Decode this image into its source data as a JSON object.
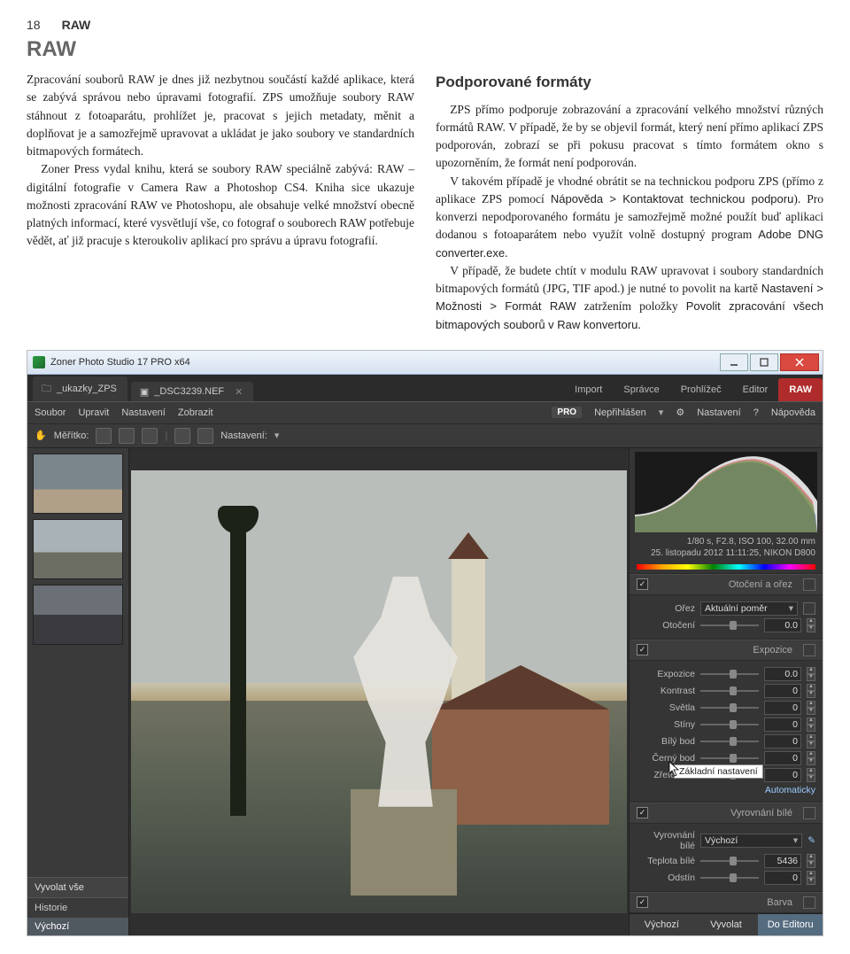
{
  "page": {
    "number": "18",
    "header": "RAW",
    "chapter_title": "RAW"
  },
  "left_column": {
    "p1": "Zpracování souborů RAW je dnes již nezbytnou součástí každé aplikace, která se zabývá správou nebo úpravami fotografií. ZPS umožňuje soubory RAW stáhnout z fotoaparátu, prohlížet je, pracovat s jejich metadaty, měnit a doplňovat je a samozřejmě upravovat a ukládat je jako soubory ve standardních bitmapových formátech.",
    "p2": "Zoner Press vydal knihu, která se soubory RAW speciálně zabývá: RAW – digitální fotografie v Camera Raw a Photoshop CS4. Kniha sice ukazuje možnosti zpracování RAW ve Photoshopu, ale obsahuje velké množství obecně platných informací, které vysvětlují vše, co fotograf o souborech RAW potřebuje vědět, ať již pracuje s kteroukoliv aplikací pro správu a úpravu fotografií."
  },
  "right_column": {
    "section_title": "Podporované formáty",
    "p1": "ZPS přímo podporuje zobrazování a zpracování velkého množství různých formátů RAW. V případě, že by se objevil formát, který není přímo aplikací ZPS podporován, zobrazí se při pokusu pracovat s tímto formátem okno s upozorněním, že formát není podporován.",
    "p2_a": "V takovém případě je vhodné obrátit se na technickou podporu ZPS (přímo z aplikace ZPS pomocí ",
    "p2_menu1": "Nápověda > Kontaktovat technickou podporu",
    "p2_b": "). Pro konverzi nepodporovaného formátu je samozřejmě možné použít buď aplikaci dodanou s fotoaparátem nebo využít volně dostupný program ",
    "p2_app": "Adobe DNG converter.exe",
    "p2_c": ".",
    "p3_a": "V případě, že budete chtít v modulu RAW upravovat i soubory standardních bitmapových formátů (JPG, TIF apod.) je nutné to povolit na kartě ",
    "p3_menu": "Nastavení > Možnosti > Formát RAW",
    "p3_b": " zatržením položky ",
    "p3_item": "Povolit zpracování všech bitmapových souborů v Raw konvertoru",
    "p3_c": "."
  },
  "app": {
    "title": "Zoner Photo Studio 17 PRO x64",
    "folder_tab": "_ukazky_ZPS",
    "file_tab": "_DSC3239.NEF",
    "modules": {
      "import": "Import",
      "manager": "Správce",
      "viewer": "Prohlížeč",
      "editor": "Editor",
      "raw": "RAW"
    },
    "menu": {
      "file": "Soubor",
      "edit": "Upravit",
      "settings": "Nastavení",
      "view": "Zobrazit"
    },
    "account": {
      "pro": "PRO",
      "status": "Nepřihlášen",
      "settings": "Nastavení",
      "help": "Nápověda"
    },
    "toolbar": {
      "scale": "Měřítko:",
      "settings": "Nastavení:"
    },
    "left": {
      "develop_all": "Vyvolat vše",
      "history": "Historie",
      "default": "Výchozí"
    },
    "exif": {
      "line1": "1/80 s, F2.8, ISO 100, 32.00 mm",
      "line2": "25. listopadu 2012 11:11:25, NIKON D800"
    },
    "tooltip": "Základní nastavení",
    "panels": {
      "crop": {
        "title": "Otočení a ořez",
        "ratio_label": "Ořez",
        "ratio_value": "Aktuální poměr",
        "rotation_label": "Otočení",
        "rotation_value": "0.0"
      },
      "exposure": {
        "title": "Expozice",
        "exposure_label": "Expozice",
        "exposure_value": "0.0",
        "contrast_label": "Kontrast",
        "contrast_value": "0",
        "highlights_label": "Světla",
        "highlights_value": "0",
        "shadows_label": "Stíny",
        "shadows_value": "0",
        "white_label": "Bílý bod",
        "white_value": "0",
        "black_label": "Černý bod",
        "black_value": "0",
        "clarity_label": "Zřetelnost",
        "clarity_value": "0",
        "auto": "Automaticky"
      },
      "wb": {
        "title": "Vyrovnání bílé",
        "preset_label": "Vyrovnání bílé",
        "preset_value": "Výchozí",
        "temp_label": "Teplota bílé",
        "temp_value": "5436",
        "tint_label": "Odstín",
        "tint_value": "0"
      },
      "color": {
        "title": "Barva"
      }
    },
    "footer": {
      "default": "Výchozí",
      "develop": "Vyvolat",
      "toeditor": "Do Editoru"
    }
  }
}
